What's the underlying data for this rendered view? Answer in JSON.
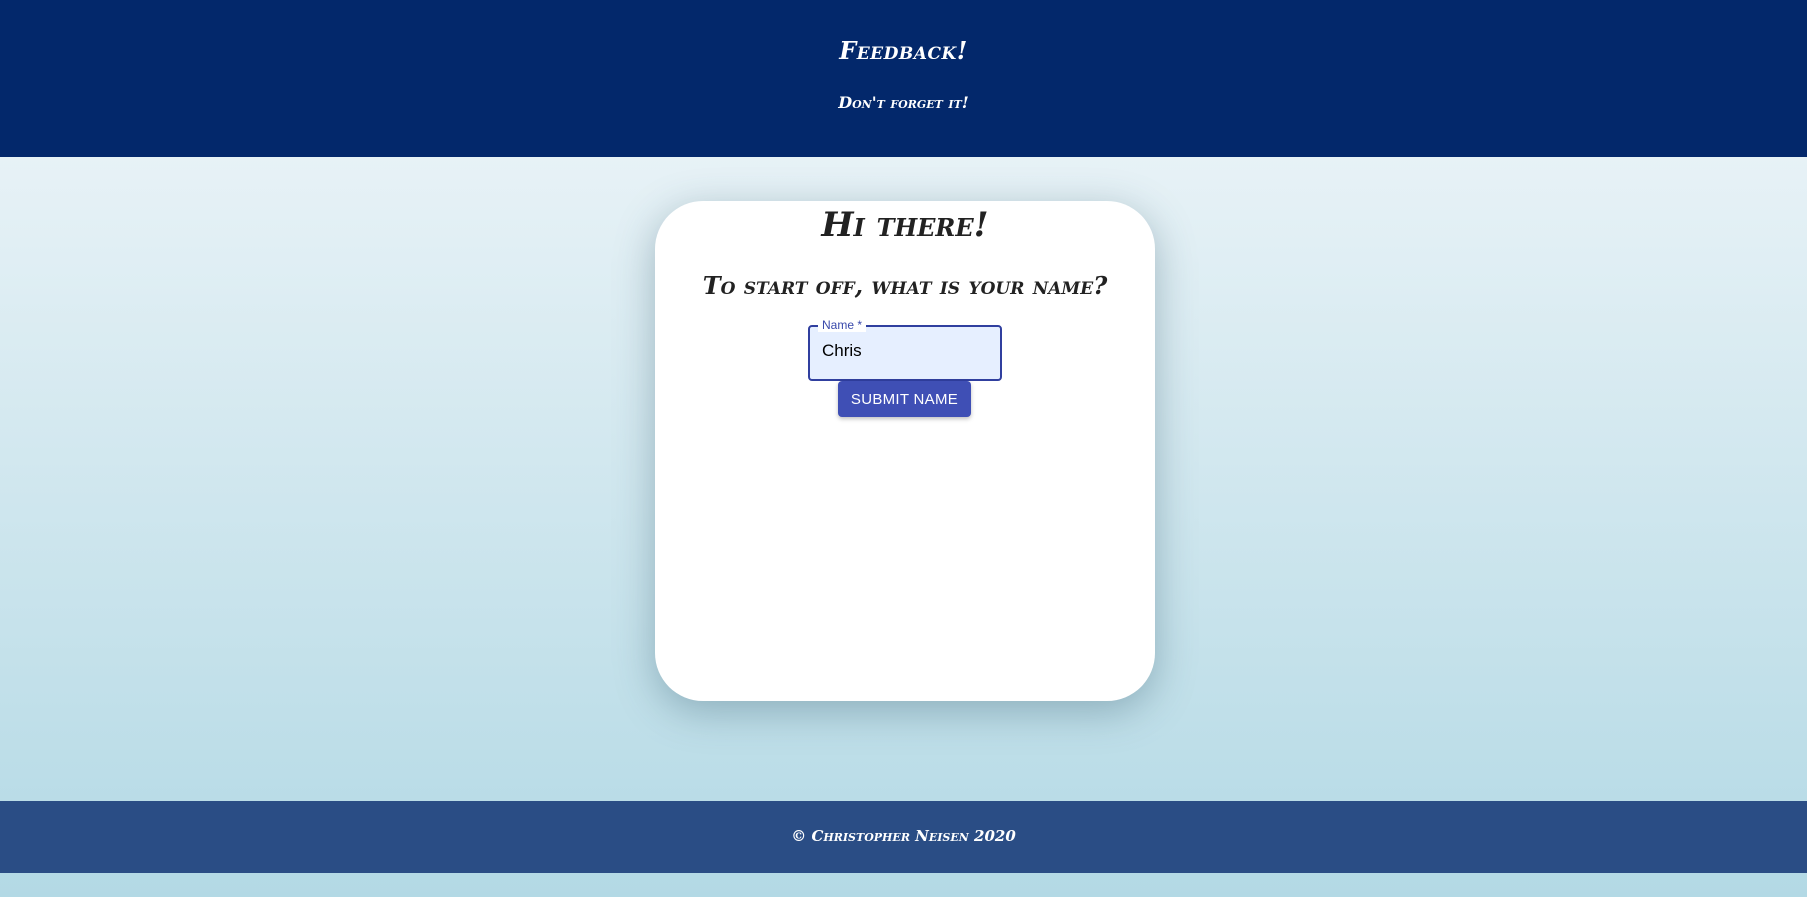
{
  "header": {
    "title": "Feedback!",
    "subtitle": "Don't forget it!"
  },
  "card": {
    "heading": "Hi there!",
    "question": "To start off, what is your name?",
    "name_field": {
      "label": "Name *",
      "value": "Chris"
    },
    "submit_label": "SUBMIT NAME"
  },
  "footer": {
    "copyright": "© Christopher Neisen 2020"
  },
  "colors": {
    "header_bg": "#03286b",
    "footer_bg": "#2a4d85",
    "accent": "#3f4fb5"
  }
}
